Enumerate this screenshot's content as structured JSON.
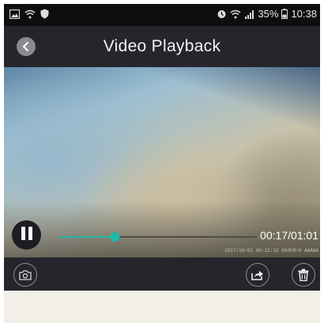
{
  "status_bar": {
    "battery_percent": "35%",
    "time": "10:38"
  },
  "header": {
    "title": "Video Playback"
  },
  "player": {
    "current_time": "00:17",
    "total_time": "01:01",
    "time_text": "00:17/01:01",
    "progress": 0.28,
    "overlay_text": "2017/10/01 00:12:32 000KM/H AAAAA"
  },
  "icons": {
    "back": "chevron-left-icon",
    "pause": "pause-icon",
    "snapshot": "camera-icon",
    "share": "share-icon",
    "delete": "trash-icon"
  },
  "colors": {
    "accent": "#1fb8a6",
    "header_bg": "#26252b",
    "status_bg": "#0e0e10",
    "page_bg": "#f1efe8"
  }
}
